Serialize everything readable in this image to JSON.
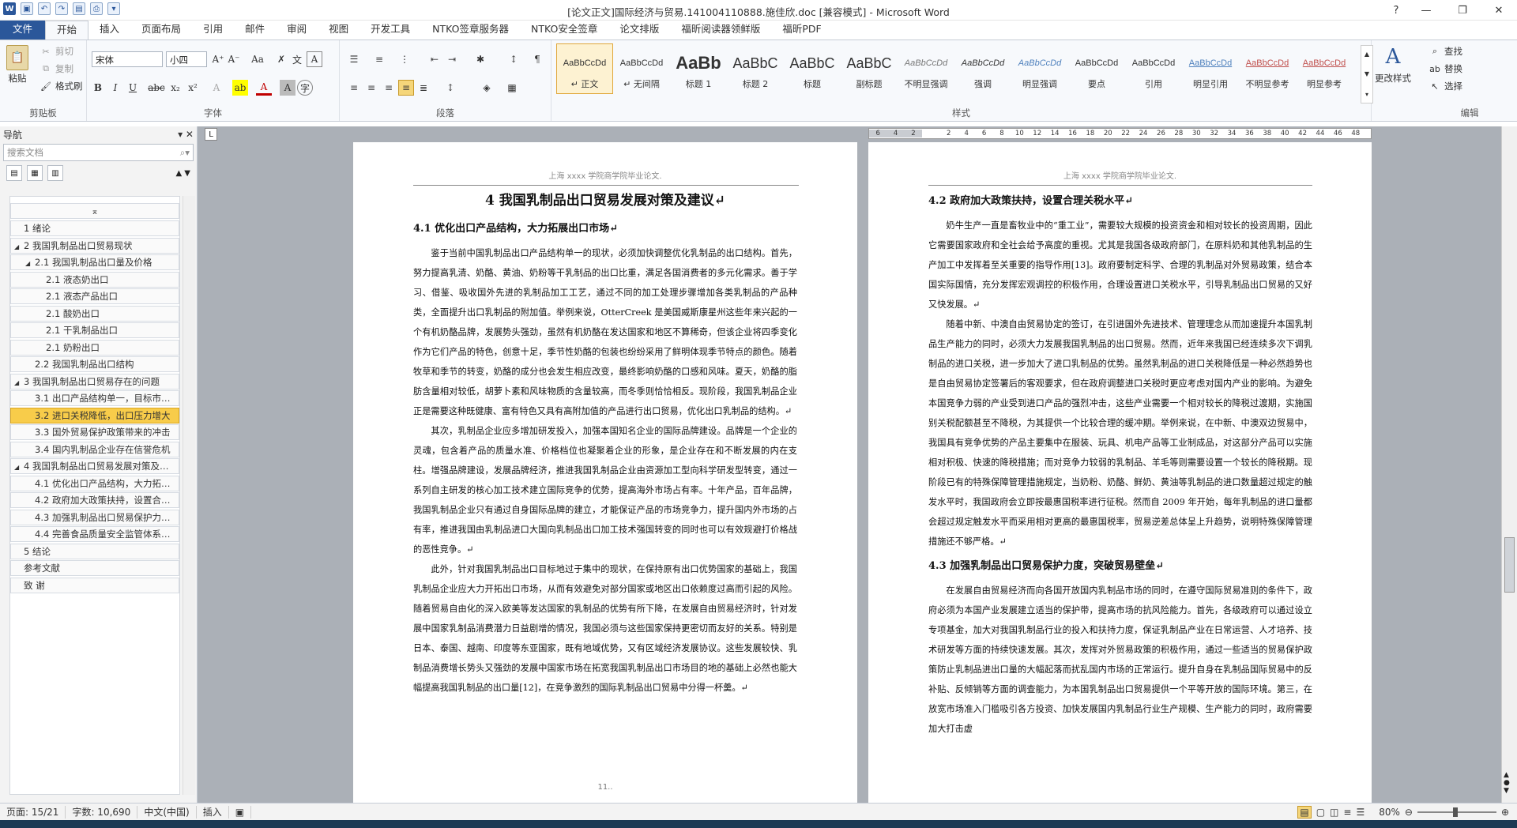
{
  "window": {
    "title": "[论文正文]国际经济与贸易.141004110888.施佳欣.doc [兼容模式] - Microsoft Word"
  },
  "tabs": [
    "文件",
    "开始",
    "插入",
    "页面布局",
    "引用",
    "邮件",
    "审阅",
    "视图",
    "开发工具",
    "NTKO签章服务器",
    "NTKO安全签章",
    "论文排版",
    "福昕阅读器领鲜版",
    "福昕PDF"
  ],
  "ribbon": {
    "clipboard": {
      "paste": "粘贴",
      "cut": "剪切",
      "copy": "复制",
      "painter": "格式刷",
      "label": "剪贴板"
    },
    "font": {
      "name": "宋体",
      "size": "小四",
      "label": "字体"
    },
    "paragraph": {
      "label": "段落"
    },
    "styles": {
      "label": "样式",
      "items": [
        {
          "preview": "AaBbCcDd",
          "name": "↵ 正文"
        },
        {
          "preview": "AaBbCcDd",
          "name": "↵ 无间隔"
        },
        {
          "preview": "AaBb",
          "name": "标题 1"
        },
        {
          "preview": "AaBbC",
          "name": "标题 2"
        },
        {
          "preview": "AaBbC",
          "name": "标题"
        },
        {
          "preview": "AaBbC",
          "name": "副标题"
        },
        {
          "preview": "AaBbCcDd",
          "name": "不明显强调"
        },
        {
          "preview": "AaBbCcDd",
          "name": "强调"
        },
        {
          "preview": "AaBbCcDd",
          "name": "明显强调"
        },
        {
          "preview": "AaBbCcDd",
          "name": "要点"
        },
        {
          "preview": "AaBbCcDd",
          "name": "引用"
        },
        {
          "preview": "AaBbCcDd",
          "name": "明显引用"
        },
        {
          "preview": "AaBbCcDd",
          "name": "不明显参考"
        },
        {
          "preview": "AaBbCcDd",
          "name": "明显参考"
        }
      ],
      "change": "更改样式"
    },
    "editing": {
      "find": "查找",
      "replace": "替换",
      "select": "选择",
      "label": "编辑"
    }
  },
  "nav": {
    "title": "导航",
    "search_placeholder": "搜索文档",
    "items": [
      "1 绪论",
      "2 我国乳制品出口贸易现状",
      "2.1 我国乳制品出口量及价格",
      "2.1 液态奶出口",
      "2.1 液态产品出口",
      "2.1 酸奶出口",
      "2.1 干乳制品出口",
      "2.1 奶粉出口",
      "2.2 我国乳制品出口结构",
      "3 我国乳制品出口贸易存在的问题",
      "3.1 出口产品结构单一，目标市…",
      "3.2 进口关税降低，出口压力增大",
      "3.3 国外贸易保护政策带来的冲击",
      "3.4 国内乳制品企业存在信誉危机",
      "4 我国乳制品出口贸易发展对策及…",
      "4.1 优化出口产品结构，大力拓…",
      "4.2 政府加大政策扶持，设置合…",
      "4.3 加强乳制品出口贸易保护力…",
      "4.4 完善食品质量安全监管体系…",
      "5 结论",
      "参考文献",
      "致  谢"
    ]
  },
  "page11": {
    "header": "上海 xxxx 学院商学院毕业论文.",
    "chapter": "4   我国乳制品出口贸易发展对策及建议↵",
    "section": "4.1   优化出口产品结构，大力拓展出口市场↵",
    "paras": [
      "鉴于当前中国乳制品出口产品结构单一的现状，必须加快调整优化乳制品的出口结构。首先，努力提高乳清、奶酪、黄油、奶粉等干乳制品的出口比重，满足各国消费者的多元化需求。善于学习、借鉴、吸收国外先进的乳制品加工工艺，通过不同的加工处理步骤增加各类乳制品的产品种类，全面提升出口乳制品的附加值。举例来说，OtterCreek 是美国威斯康星州这些年来兴起的一个有机奶酪品牌，发展势头强劲，虽然有机奶酪在发达国家和地区不算稀奇，但该企业将四季变化作为它们产品的特色，创意十足，季节性奶酪的包装也纷纷采用了鲜明体现季节特点的颜色。随着牧草和季节的转变，奶酪的成分也会发生相应改变，最终影响奶酪的口感和风味。夏天，奶酪的脂肪含量相对较低，胡萝卜素和风味物质的含量较高，而冬季则恰恰相反。现阶段，我国乳制品企业正是需要这种既健康、富有特色又具有高附加值的产品进行出口贸易，优化出口乳制品的结构。↵",
      "其次，乳制品企业应多增加研发投入，加强本国知名企业的国际品牌建设。品牌是一个企业的灵魂，包含着产品的质量水准、价格档位也凝聚着企业的形象，是企业存在和不断发展的内在支柱。增强品牌建设，发展品牌经济，推进我国乳制品企业由资源加工型向科学研发型转变，通过一系列自主研发的核心加工技术建立国际竞争的优势，提高海外市场占有率。十年产品，百年品牌，我国乳制品企业只有通过自身国际品牌的建立，才能保证产品的市场竞争力，提升国内外市场的占有率，推进我国由乳制品进口大国向乳制品出口加工技术强国转变的同时也可以有效规避打价格战的恶性竞争。↵",
      "此外，针对我国乳制品出口目标地过于集中的现状，在保持原有出口优势国家的基础上，我国乳制品企业应大力开拓出口市场，从而有效避免对部分国家或地区出口依赖度过高而引起的风险。随着贸易自由化的深入欧美等发达国家的乳制品的优势有所下降，在发展自由贸易经济时，针对发展中国家乳制品消费潜力日益剧增的情况，我国必须与这些国家保持更密切而友好的关系。特别是日本、泰国、越南、印度等东亚国家，既有地域优势，又有区域经济发展协议。这些发展较快、乳制品消费增长势头又强劲的发展中国家市场在拓宽我国乳制品出口市场目的地的基础上必然也能大幅提高我国乳制品的出口量[12]，在竞争激烈的国际乳制品出口贸易中分得一杯羹。↵"
    ],
    "pagenum": "11.."
  },
  "page12": {
    "header": "上海 xxxx 学院商学院毕业论文.",
    "section1": "4.2   政府加大政策扶持，设置合理关税水平↵",
    "paras1": [
      "奶牛生产一直是畜牧业中的“重工业”，需要较大规模的投资资金和相对较长的投资周期，因此它需要国家政府和全社会给予高度的重视。尤其是我国各级政府部门，在原料奶和其他乳制品的生产加工中发挥着至关重要的指导作用[13]。政府要制定科学、合理的乳制品对外贸易政策，结合本国实际国情，充分发挥宏观调控的积极作用，合理设置进口关税水平，引导乳制品出口贸易的又好又快发展。↵",
      "随着中新、中澳自由贸易协定的签订，在引进国外先进技术、管理理念从而加速提升本国乳制品生产能力的同时，必须大力发展我国乳制品的出口贸易。然而，近年来我国已经连续多次下调乳制品的进口关税，进一步加大了进口乳制品的优势。虽然乳制品的进口关税降低是一种必然趋势也是自由贸易协定签署后的客观要求，但在政府调整进口关税时更应考虑对国内产业的影响。为避免本国竞争力弱的产业受到进口产品的强烈冲击，这些产业需要一个相对较长的降税过渡期，实施国别关税配额甚至不降税，为其提供一个比较合理的缓冲期。举例来说，在中新、中澳双边贸易中，我国具有竞争优势的产品主要集中在服装、玩具、机电产品等工业制成品，对这部分产品可以实施相对积极、快速的降税措施；而对竞争力较弱的乳制品、羊毛等则需要设置一个较长的降税期。现阶段已有的特殊保障管理措施规定，当奶粉、奶酪、鲜奶、黄油等乳制品的进口数量超过规定的触发水平时，我国政府会立即按最惠国税率进行征税。然而自 2009 年开始，每年乳制品的进口量都会超过规定触发水平而采用相对更高的最惠国税率，贸易逆差总体呈上升趋势，说明特殊保障管理措施还不够严格。↵"
    ],
    "section2": "4.3   加强乳制品出口贸易保护力度，突破贸易壁垒↵",
    "paras2": [
      "在发展自由贸易经济而向各国开放国内乳制品市场的同时，在遵守国际贸易准则的条件下，政府必须为本国产业发展建立适当的保护带，提高市场的抗风险能力。首先，各级政府可以通过设立专项基金，加大对我国乳制品行业的投入和扶持力度，保证乳制品产业在日常运营、人才培养、技术研发等方面的持续快速发展。其次，发挥对外贸易政策的积极作用，通过一些适当的贸易保护政策防止乳制品进出口量的大幅起落而扰乱国内市场的正常运行。提升自身在乳制品国际贸易中的反补贴、反倾销等方面的调查能力，为本国乳制品出口贸易提供一个平等开放的国际环境。第三，在放宽市场准入门槛吸引各方投资、加快发展国内乳制品行业生产规模、生产能力的同时，政府需要加大打击虚"
    ],
    "pagenum": "12.."
  },
  "ruler": [
    "6",
    "4",
    "2",
    "",
    "2",
    "4",
    "6",
    "8",
    "10",
    "12",
    "14",
    "16",
    "18",
    "20",
    "22",
    "24",
    "26",
    "28",
    "30",
    "32",
    "34",
    "36",
    "38",
    "40",
    "42",
    "44",
    "46",
    "48"
  ],
  "status": {
    "page": "页面: 15/21",
    "words": "字数: 10,690",
    "lang": "中文(中国)",
    "mode": "插入",
    "zoom": "80%"
  }
}
